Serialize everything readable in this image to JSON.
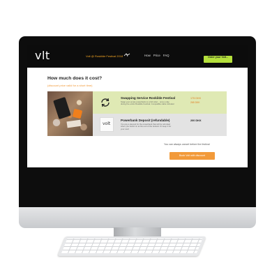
{
  "navbar": {
    "logo": "vlt",
    "event": "Volt @ Roskilde Festival 2018",
    "links": [
      "How",
      "Price",
      "FAQ"
    ],
    "cta": "Order your Volt..."
  },
  "main": {
    "heading": "How much does it cost?",
    "subheading": "(discount price valid for a short time)",
    "items": [
      {
        "title": "Swapping Service Roskilde Festival",
        "desc": "Swap your empty powerbank to a full rebel... once a day during the entire Roskilde Festival. Compatible cable included",
        "price": "175 DKK",
        "old_price": "265 DKK"
      },
      {
        "title": "Powerbank Deposit (refundable)",
        "desc": "You pay a deposit for the powerbank that will be refunded when you hand it in at the end of the festival. Or keep it for your own!",
        "price": "200 DKK",
        "thumb": "volt"
      }
    ],
    "note": "You can always cancel before the festival",
    "cta": "Book Volt with discount"
  },
  "colors": {
    "accent_green": "#b5e03c",
    "accent_orange": "#f29a3a",
    "nav_background": "#0c0c0c"
  }
}
